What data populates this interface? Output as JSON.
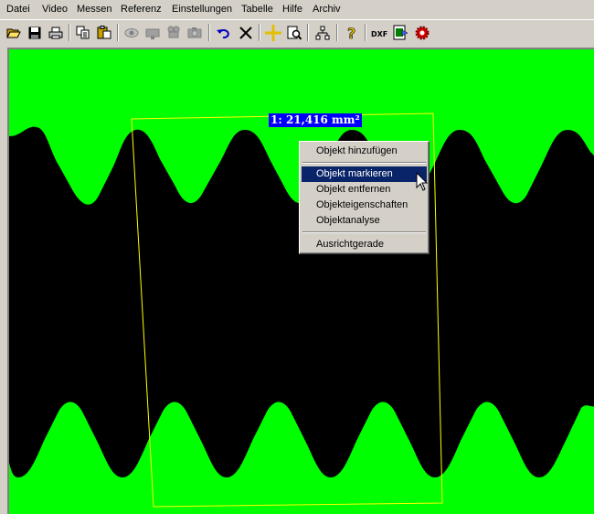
{
  "menubar": {
    "items": [
      "Datei",
      "Video",
      "Messen",
      "Referenz",
      "Einstellungen",
      "Tabelle",
      "Hilfe",
      "Archiv"
    ]
  },
  "toolbar": {
    "buttons": [
      {
        "name": "open-folder-icon"
      },
      {
        "name": "save-disk-icon"
      },
      {
        "name": "print-icon"
      },
      {
        "name": "copy-icon"
      },
      {
        "name": "paste-icon"
      },
      {
        "name": "eye-icon"
      },
      {
        "name": "camera-icon"
      },
      {
        "name": "video-camera-icon"
      },
      {
        "name": "camera-snapshot-icon"
      },
      {
        "name": "undo-icon"
      },
      {
        "name": "delete-x-icon"
      },
      {
        "name": "crosshair-icon"
      },
      {
        "name": "page-preview-icon"
      },
      {
        "name": "tree-hierarchy-icon"
      },
      {
        "name": "help-question-icon"
      },
      {
        "name": "dxf-export-icon"
      },
      {
        "name": "excel-export-icon"
      },
      {
        "name": "gear-settings-icon"
      }
    ],
    "dxf_label": "DXF"
  },
  "canvas": {
    "colors": {
      "background": "#00ff00",
      "part": "#000000",
      "selection": "#ffff00"
    },
    "measurement_label": "1: 21,416 mm²"
  },
  "context_menu": {
    "items": [
      {
        "label": "Objekt hinzufügen",
        "selected": false
      },
      {
        "label": "Objekt markieren",
        "selected": true
      },
      {
        "label": "Objekt entfernen",
        "selected": false
      },
      {
        "label": "Objekteigenschaften",
        "selected": false
      },
      {
        "label": "Objektanalyse",
        "selected": false
      },
      {
        "label": "Ausrichtgerade",
        "selected": false
      }
    ]
  }
}
